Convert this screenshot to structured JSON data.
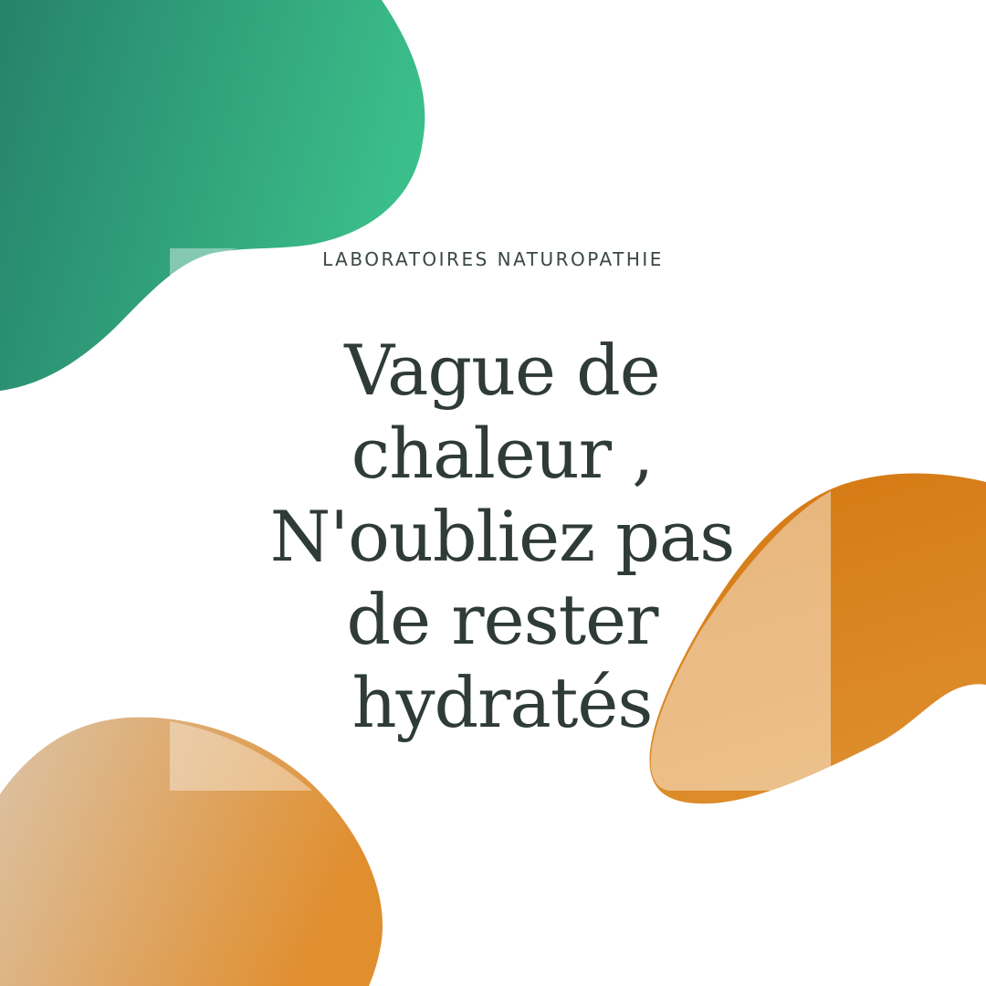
{
  "brand": {
    "name": "LABORATOIRES NATUROPATHIE"
  },
  "headline": {
    "lines": [
      "Vague de",
      "chaleur ,",
      "N'oubliez pas",
      "de rester",
      "hydratés"
    ]
  },
  "colors": {
    "background": "#ffffff",
    "green_dark": "#26826b",
    "green_light": "#3bbf8a",
    "orange_dark": "#d47812",
    "orange_light": "#ecbd85",
    "beige": "#dcc3a6",
    "text": "#2f3b37"
  }
}
